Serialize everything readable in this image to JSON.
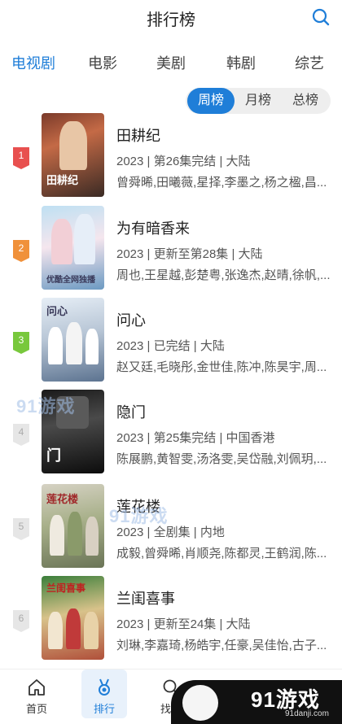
{
  "header": {
    "title": "排行榜",
    "search_icon": "search-icon"
  },
  "tabs": [
    {
      "label": "电视剧",
      "active": true
    },
    {
      "label": "电影",
      "active": false
    },
    {
      "label": "美剧",
      "active": false
    },
    {
      "label": "韩剧",
      "active": false
    },
    {
      "label": "综艺",
      "active": false
    }
  ],
  "period": [
    {
      "label": "周榜",
      "active": true
    },
    {
      "label": "月榜",
      "active": false
    },
    {
      "label": "总榜",
      "active": false
    }
  ],
  "items": [
    {
      "rank": "1",
      "title": "田耕纪",
      "meta": "2023 | 第26集完结 | 大陆",
      "cast": "曾舜晞,田曦薇,星择,李墨之,杨之楹,昌...",
      "poster_text": "田耕纪"
    },
    {
      "rank": "2",
      "title": "为有暗香来",
      "meta": "2023 | 更新至第28集 | 大陆",
      "cast": "周也,王星越,彭楚粤,张逸杰,赵晴,徐帆,...",
      "poster_text": "优酷全网独播"
    },
    {
      "rank": "3",
      "title": "问心",
      "meta": "2023 | 已完结 | 大陆",
      "cast": "赵又廷,毛晓彤,金世佳,陈冲,陈昊宇,周...",
      "poster_text": "问心"
    },
    {
      "rank": "4",
      "title": "隐门",
      "meta": "2023 | 第25集完结 | 中国香港",
      "cast": "陈展鹏,黄智雯,汤洛雯,吴岱融,刘佩玥,...",
      "poster_text": "门"
    },
    {
      "rank": "5",
      "title": "莲花楼",
      "meta": "2023 | 全剧集 | 内地",
      "cast": "成毅,曾舜晞,肖顺尧,陈都灵,王鹤润,陈...",
      "poster_text": "莲花楼"
    },
    {
      "rank": "6",
      "title": "兰闺喜事",
      "meta": "2023 | 更新至24集 | 大陆",
      "cast": "刘琳,李嘉琦,杨皓宇,任豪,吴佳怡,古子...",
      "poster_text": "兰闺喜事"
    }
  ],
  "watermarks": [
    "91游戏",
    "91游戏"
  ],
  "bottom_nav": [
    {
      "label": "首页",
      "icon": "home-icon",
      "active": false
    },
    {
      "label": "排行",
      "icon": "medal-icon",
      "active": true
    },
    {
      "label": "找片",
      "icon": "search-icon",
      "active": false
    }
  ],
  "overlay": {
    "brand": "91游戏",
    "url": "91danji.com"
  },
  "colors": {
    "accent": "#1f7ed8",
    "rank1": "#e8504f",
    "rank2": "#f0913a",
    "rank3": "#78c83c"
  }
}
